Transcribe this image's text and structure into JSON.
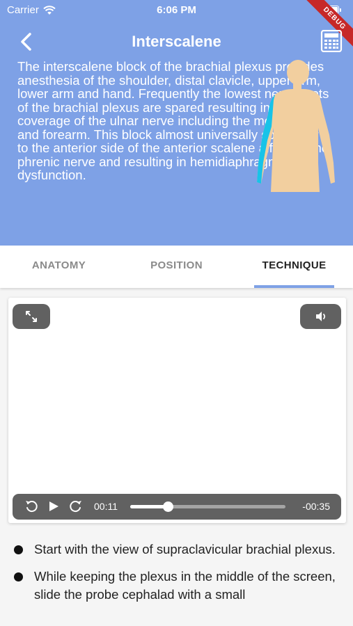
{
  "status_bar": {
    "carrier": "Carrier",
    "time": "6:06 PM"
  },
  "debug_banner": "DEBUG",
  "header": {
    "title": "Interscalene",
    "description": "The interscalene block of the brachial plexus provides anesthesia of the shoulder, distal clavicle, upper arm, lower arm and hand. Frequently the lowest nerve roots of the brachial plexus are spared resulting in poor coverage of the ulnar nerve including the medial hand and forearm. This block almost universally spills over to the anterior side of the anterior scalene affecting the phrenic nerve and resulting in hemidiaphragmatic dysfunction.",
    "back_icon": "chevron-left-icon",
    "calculator_icon": "calculator-icon"
  },
  "tabs": [
    {
      "label": "ANATOMY",
      "active": false
    },
    {
      "label": "POSITION",
      "active": false
    },
    {
      "label": "TECHNIQUE",
      "active": true
    }
  ],
  "player": {
    "current_time": "00:11",
    "remaining_time": "-00:35",
    "progress": 0.24,
    "icons": [
      "fullscreen-icon",
      "volume-icon",
      "replay-icon",
      "play-icon",
      "refresh-icon"
    ]
  },
  "steps": [
    "Start with the view of supraclavicular brachial plexus.",
    "While keeping the plexus in the middle of the screen, slide the probe cephalad with a small"
  ],
  "colors": {
    "header_bg": "#7ea1e6",
    "tab_indicator": "#7ea1e6",
    "body_skin": "#f2cf9f",
    "block_highlight": "#18c3e8",
    "player_controls": "#616161",
    "debug_banner": "#c62828"
  }
}
